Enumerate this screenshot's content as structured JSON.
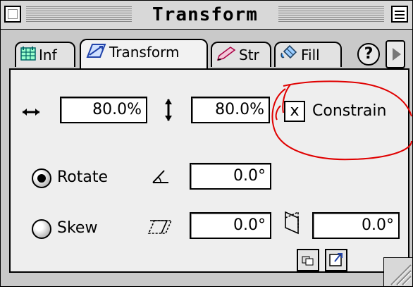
{
  "window": {
    "title": "Transform"
  },
  "tabs": [
    {
      "label": "Inf",
      "icon": "info-grid-icon"
    },
    {
      "label": "Transform",
      "icon": "transform-icon",
      "active": true
    },
    {
      "label": "Str",
      "icon": "stroke-pencil-icon"
    },
    {
      "label": "Fill",
      "icon": "fill-bucket-icon"
    }
  ],
  "help_label": "?",
  "scale": {
    "horizontal_value": "80.0%",
    "vertical_value": "80.0%",
    "constrain_label": "Constrain",
    "constrain_mark": "x"
  },
  "rotate": {
    "label": "Rotate",
    "selected": true,
    "value": "0.0°"
  },
  "skew": {
    "label": "Skew",
    "selected": false,
    "horizontal_value": "0.0°",
    "vertical_value": "0.0°"
  },
  "colors": {
    "annotation": "#e00000",
    "window_bg": "#c9c9c9",
    "panel_bg": "#eeeeee"
  }
}
